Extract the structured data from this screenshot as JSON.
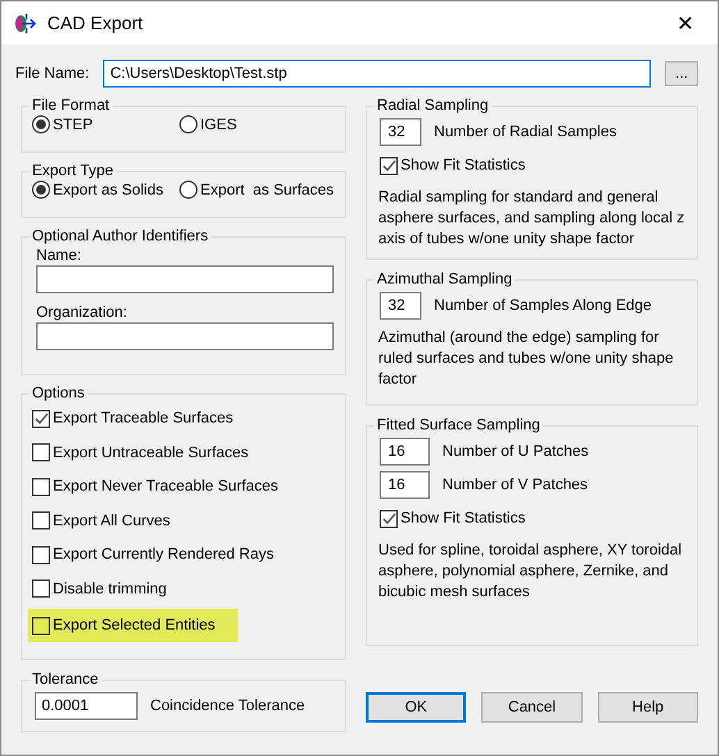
{
  "window": {
    "title": "CAD Export",
    "close": "✕"
  },
  "file_name": {
    "label": "File Name:",
    "value": "C:\\Users\\Desktop\\Test.stp",
    "browse": "..."
  },
  "file_format": {
    "title": "File Format",
    "options": [
      {
        "label": "STEP",
        "selected": true
      },
      {
        "label": "IGES",
        "selected": false
      }
    ]
  },
  "export_type": {
    "title": "Export Type",
    "options": [
      {
        "label": "Export as Solids",
        "selected": true
      },
      {
        "label": "Export  as Surfaces",
        "selected": false
      }
    ]
  },
  "author": {
    "title": "Optional Author Identifiers",
    "fields": [
      {
        "label": "Name:"
      },
      {
        "label": "Organization:"
      }
    ]
  },
  "options": {
    "title": "Options",
    "items": [
      {
        "label": "Export Traceable Surfaces",
        "checked": true,
        "highlighted": false
      },
      {
        "label": "Export Untraceable Surfaces",
        "checked": false,
        "highlighted": false
      },
      {
        "label": "Export Never Traceable Surfaces",
        "checked": false,
        "highlighted": false
      },
      {
        "label": "Export All Curves",
        "checked": false,
        "highlighted": false
      },
      {
        "label": "Export Currently Rendered Rays",
        "checked": false,
        "highlighted": false
      },
      {
        "label": "Disable trimming",
        "checked": false,
        "highlighted": false
      },
      {
        "label": "Export Selected Entities",
        "checked": false,
        "highlighted": true
      }
    ]
  },
  "tolerance": {
    "title": "Tolerance",
    "value": "0.0001",
    "label": "Coincidence Tolerance"
  },
  "radial": {
    "title": "Radial Sampling",
    "inputs": [
      {
        "value": "32",
        "label": "Number of Radial Samples"
      }
    ],
    "show_fit": {
      "label": "Show Fit Statistics",
      "checked": true
    },
    "description": "Radial sampling for standard and general asphere surfaces, and sampling along local z axis of tubes w/one unity shape factor"
  },
  "azimuthal": {
    "title": "Azimuthal Sampling",
    "inputs": [
      {
        "value": "32",
        "label": "Number of Samples Along Edge"
      }
    ],
    "description": "Azimuthal (around the edge) sampling for ruled surfaces and tubes w/one unity shape factor"
  },
  "fitted": {
    "title": "Fitted Surface Sampling",
    "inputs": [
      {
        "value": "16",
        "label": "Number of U Patches"
      },
      {
        "value": "16",
        "label": "Number of V Patches"
      }
    ],
    "show_fit": {
      "label": "Show Fit Statistics",
      "checked": true
    },
    "description": "Used for spline, toroidal asphere, XY toroidal asphere, polynomial asphere, Zernike, and bicubic mesh surfaces"
  },
  "buttons": [
    {
      "label": "OK",
      "default": true
    },
    {
      "label": "Cancel",
      "default": false
    },
    {
      "label": "Help",
      "default": false
    }
  ]
}
